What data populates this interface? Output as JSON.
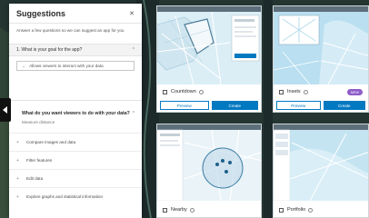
{
  "panel": {
    "title": "Suggestions",
    "close_icon": "close-icon",
    "intro": "Answer a few questions so we can suggest an app for you",
    "question1": {
      "label": "1. What is your goal for the app?",
      "answer": "Allows viewers to interact with your data"
    },
    "question2": {
      "label": "What do you want viewers to do with your data?",
      "subtext": "Measure distance"
    },
    "options": [
      "Compare images and data",
      "Filter features",
      "Edit data",
      "Explore graphs and statistical information"
    ]
  },
  "gallery": {
    "cards": [
      {
        "title": "Countdown",
        "preview_label": "Preview",
        "create_label": "Create"
      },
      {
        "title": "Insets",
        "badge": "NEW",
        "preview_label": "Preview",
        "create_label": "Create"
      },
      {
        "title": "Nearby"
      },
      {
        "title": "Portfolio"
      }
    ]
  },
  "colors": {
    "accent": "#0079c1",
    "badge": "#8e5dc9",
    "panel_bg": "#ffffff",
    "map_water": "#cfe7f3",
    "map_land": "#f7f7f2"
  }
}
